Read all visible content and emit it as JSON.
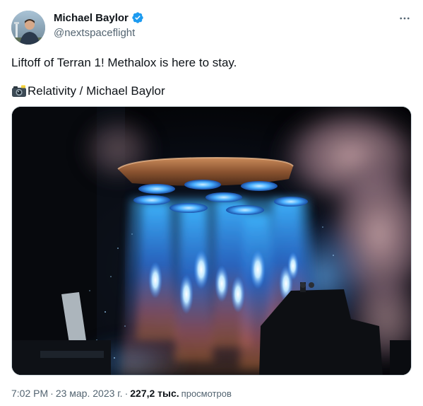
{
  "author": {
    "display_name": "Michael Baylor",
    "handle": "@nextspaceflight",
    "verified": true
  },
  "tweet": {
    "text": "Liftoff of Terran 1! Methalox is here to stay.",
    "credit_emoji": "camera-with-flash-icon",
    "credit_text": "Relativity / Michael Baylor"
  },
  "meta": {
    "time": "7:02 PM",
    "separator": "·",
    "date": "23 мар. 2023 г.",
    "views_count": "227,2 тыс.",
    "views_label": "просмотров"
  },
  "colors": {
    "text_primary": "#0f1419",
    "text_secondary": "#536471",
    "verified_blue": "#1d9bf0",
    "border": "#cfd9de",
    "flame_blue": "#3fb6ff",
    "flame_orange": "#e0823a"
  },
  "icons": {
    "verified": "verified-badge-icon",
    "more": "more-horizontal-icon",
    "credit": "camera-with-flash-icon"
  }
}
